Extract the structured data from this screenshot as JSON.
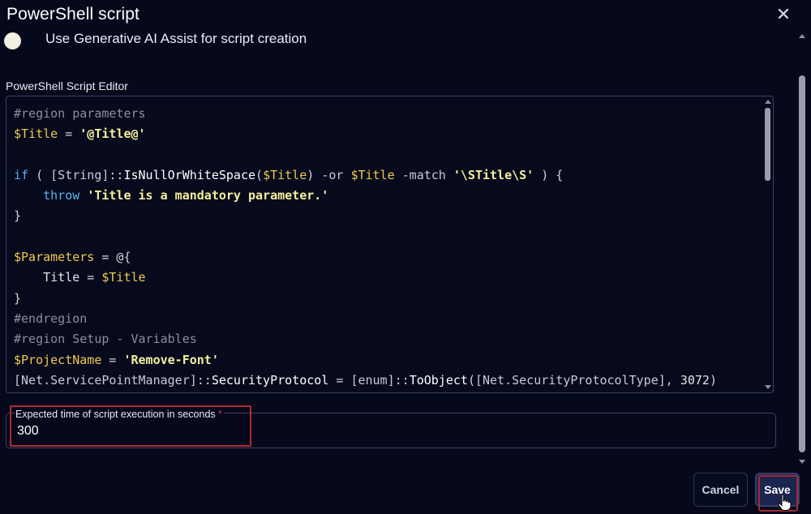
{
  "dialog": {
    "title": "PowerShell script",
    "close_icon": "close-icon"
  },
  "ai_assist": {
    "label": "Use Generative AI Assist for script creation"
  },
  "editor": {
    "label": "PowerShell Script Editor",
    "lines": [
      [
        {
          "t": "#region parameters",
          "c": "comment"
        }
      ],
      [
        {
          "t": "$Title",
          "c": "var"
        },
        {
          "t": " = ",
          "c": "op"
        },
        {
          "t": "'@Title@'",
          "c": "str"
        }
      ],
      [],
      [
        {
          "t": "if",
          "c": "kw"
        },
        {
          "t": " ( ",
          "c": "op"
        },
        {
          "t": "[String]",
          "c": "type"
        },
        {
          "t": "::",
          "c": "op"
        },
        {
          "t": "IsNullOrWhiteSpace",
          "c": "method"
        },
        {
          "t": "(",
          "c": "op"
        },
        {
          "t": "$Title",
          "c": "var"
        },
        {
          "t": ") ",
          "c": "op"
        },
        {
          "t": "-or",
          "c": "type"
        },
        {
          "t": " ",
          "c": "op"
        },
        {
          "t": "$Title",
          "c": "var"
        },
        {
          "t": " ",
          "c": "op"
        },
        {
          "t": "-match",
          "c": "type"
        },
        {
          "t": " ",
          "c": "op"
        },
        {
          "t": "'\\STitle\\S'",
          "c": "str"
        },
        {
          "t": " ) {",
          "c": "op"
        }
      ],
      [
        {
          "t": "    ",
          "c": "op"
        },
        {
          "t": "throw",
          "c": "kw"
        },
        {
          "t": " ",
          "c": "op"
        },
        {
          "t": "'Title is a mandatory parameter.'",
          "c": "str"
        }
      ],
      [
        {
          "t": "}",
          "c": "op"
        }
      ],
      [],
      [
        {
          "t": "$Parameters",
          "c": "var"
        },
        {
          "t": " = @{",
          "c": "op"
        }
      ],
      [
        {
          "t": "    Title",
          "c": "plain"
        },
        {
          "t": " = ",
          "c": "op"
        },
        {
          "t": "$Title",
          "c": "var"
        }
      ],
      [
        {
          "t": "}",
          "c": "op"
        }
      ],
      [
        {
          "t": "#endregion",
          "c": "comment"
        }
      ],
      [
        {
          "t": "#region Setup - Variables",
          "c": "comment"
        }
      ],
      [
        {
          "t": "$ProjectName",
          "c": "var"
        },
        {
          "t": " = ",
          "c": "op"
        },
        {
          "t": "'Remove-Font'",
          "c": "str"
        }
      ],
      [
        {
          "t": "[Net.ServicePointManager]",
          "c": "type"
        },
        {
          "t": "::",
          "c": "op"
        },
        {
          "t": "SecurityProtocol",
          "c": "method"
        },
        {
          "t": " = ",
          "c": "op"
        },
        {
          "t": "[enum]",
          "c": "type"
        },
        {
          "t": "::",
          "c": "op"
        },
        {
          "t": "ToObject",
          "c": "method"
        },
        {
          "t": "(",
          "c": "op"
        },
        {
          "t": "[Net.SecurityProtocolType]",
          "c": "type"
        },
        {
          "t": ", ",
          "c": "op"
        },
        {
          "t": "3072",
          "c": "num"
        },
        {
          "t": ")",
          "c": "op"
        }
      ]
    ]
  },
  "execution_time": {
    "label": "Expected time of script execution in seconds",
    "required_mark": "*",
    "value": "300"
  },
  "buttons": {
    "cancel": "Cancel",
    "save": "Save"
  },
  "colors": {
    "background": "#06091c",
    "highlight": "#b02a32",
    "save_bg": "#1a2550"
  }
}
